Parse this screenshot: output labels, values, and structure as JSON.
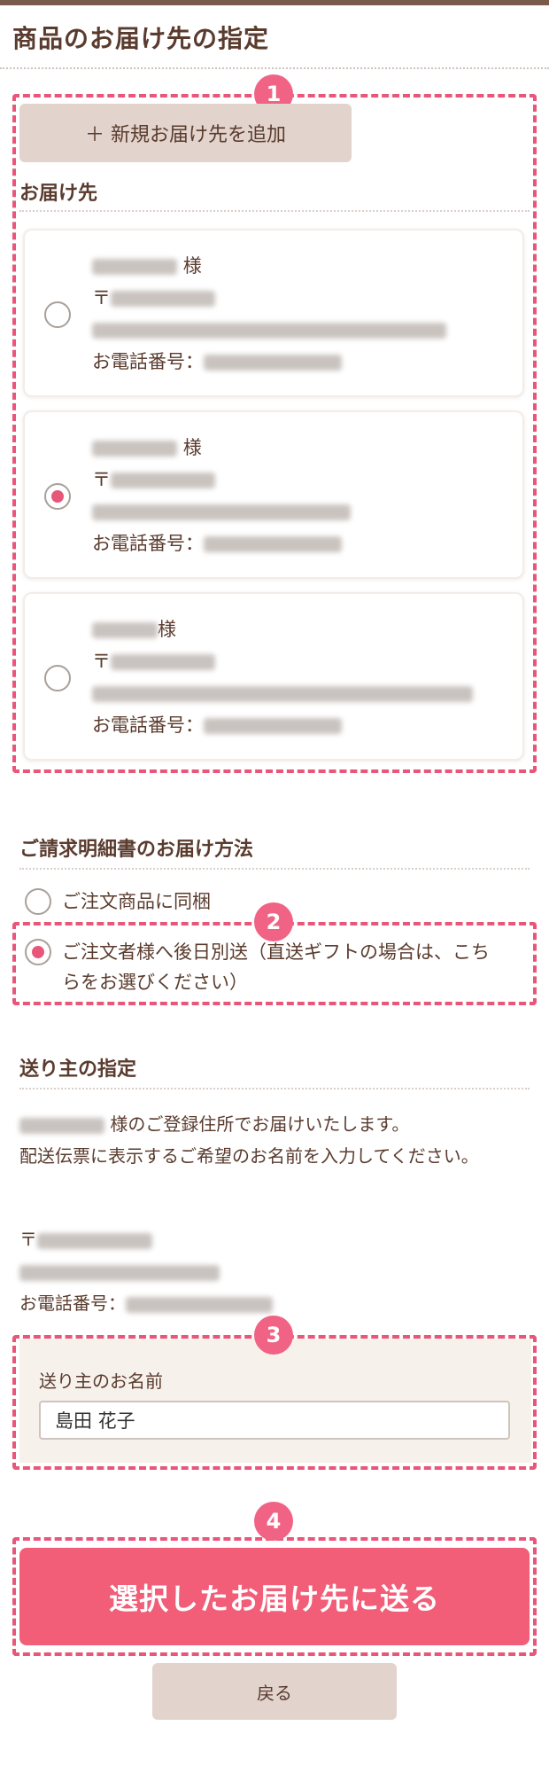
{
  "page": {
    "title": "商品のお届け先の指定"
  },
  "badges": [
    "1",
    "2",
    "3",
    "4"
  ],
  "delivery": {
    "add_button": "＋ 新規お届け先を追加",
    "heading": "お届け先",
    "addresses": [
      {
        "name_suffix": "様",
        "postal_mark": "〒",
        "phone_label": "お電話番号：",
        "selected": false
      },
      {
        "name_suffix": "様",
        "postal_mark": "〒",
        "phone_label": "お電話番号：",
        "selected": true
      },
      {
        "name_suffix": "様",
        "postal_mark": "〒",
        "phone_label": "お電話番号：",
        "selected": false
      }
    ]
  },
  "invoice": {
    "heading": "ご請求明細書のお届け方法",
    "options": [
      {
        "label": "ご注文商品に同梱",
        "selected": false
      },
      {
        "label": "ご注文者様へ後日別送（直送ギフトの場合は、こちらをお選びください）",
        "selected": true
      }
    ]
  },
  "sender": {
    "heading": "送り主の指定",
    "intro_suffix": "様のご登録住所でお届けいたします。",
    "intro_line2": "配送伝票に表示するご希望のお名前を入力してください。",
    "postal_mark": "〒",
    "phone_label": "お電話番号：",
    "name_label": "送り主のお名前",
    "name_value": "島田 花子"
  },
  "actions": {
    "submit": "選択したお届け先に送る",
    "back": "戻る"
  },
  "colors": {
    "accent": "#f25d78",
    "dash": "#e8577a",
    "text": "#5a3b2e",
    "button_neutral": "#e2d3cc"
  }
}
